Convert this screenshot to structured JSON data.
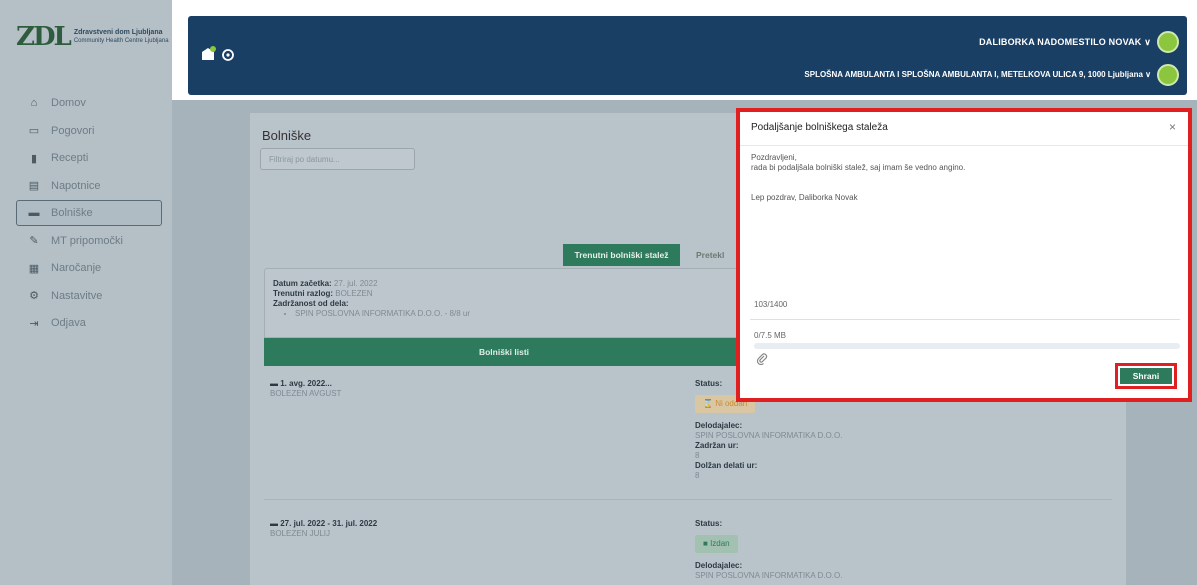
{
  "sidebar": {
    "logo_mark": "ZDL",
    "logo_name": "Zdravstveni dom Ljubljana",
    "logo_sub": "Community Health Centre Ljubljana",
    "items": [
      {
        "label": "Domov",
        "icon": "home-icon",
        "glyph": "⌂"
      },
      {
        "label": "Pogovori",
        "icon": "chat-icon",
        "glyph": "▭"
      },
      {
        "label": "Recepti",
        "icon": "prescription-icon",
        "glyph": "▮"
      },
      {
        "label": "Napotnice",
        "icon": "referral-icon",
        "glyph": "▤"
      },
      {
        "label": "Bolniške",
        "icon": "bed-icon",
        "glyph": "▬"
      },
      {
        "label": "MT pripomočki",
        "icon": "tool-icon",
        "glyph": "✎"
      },
      {
        "label": "Naročanje",
        "icon": "calendar-icon",
        "glyph": "▦"
      },
      {
        "label": "Nastavitve",
        "icon": "gear-icon",
        "glyph": "⚙"
      },
      {
        "label": "Odjava",
        "icon": "logout-icon",
        "glyph": "⇥"
      }
    ]
  },
  "header": {
    "user": "DALIBORKA NADOMESTILO NOVAK ∨",
    "location": "SPLOŠNA AMBULANTA I SPLOŠNA AMBULANTA I, METELKOVA ULICA 9, 1000 Ljubljana ∨"
  },
  "content": {
    "title": "Bolniške",
    "filter_placeholder": "Filtriraj po datumu...",
    "tab_current": "Trenutni bolniški stalež",
    "tab_past": "Pretekl",
    "info": {
      "start_label": "Datum začetka:",
      "start_value": "27. jul. 2022",
      "reason_label": "Trenutni razlog:",
      "reason_value": "BOLEZEN",
      "absence_label": "Zadržanost od dela:",
      "employer_item": "SPIN POSLOVNA INFORMATIKA D.O.O. - 8/8 ur"
    },
    "sick_notes_bar": "Bolniški listi",
    "entries": [
      {
        "date": "1. avg. 2022...",
        "desc": "BOLEZEN AVGUST",
        "status_label": "Status:",
        "status_value": "Ni oddan",
        "employer_label": "Delodajalec:",
        "employer_value": "SPIN POSLOVNA INFORMATIKA D.O.O.",
        "hours_label": "Zadržan ur:",
        "hours_value": "8",
        "work_label": "Dolžan delati ur:",
        "work_value": "8"
      },
      {
        "date": "27. jul. 2022 - 31. jul. 2022",
        "desc": "BOLEZEN JULIJ",
        "status_label": "Status:",
        "status_value": "Izdan",
        "employer_label": "Delodajalec:",
        "employer_value": "SPIN POSLOVNA INFORMATIKA D.O.O."
      }
    ]
  },
  "modal": {
    "title": "Podaljšanje bolniškega staleža",
    "close": "×",
    "line1": "Pozdravljeni,",
    "line2": "rada bi podaljšala bolniški stalež, saj imam še vedno angino.",
    "line3": "Lep pozdrav, Daliborka Novak",
    "char_count": "103/1400",
    "file_size": "0/7.5 MB",
    "upload_fraction": 0,
    "save_label": "Shrani"
  },
  "colors": {
    "primary_green": "#2d7a5c",
    "header_navy": "#1a3f64",
    "highlight_red": "#e02020"
  }
}
